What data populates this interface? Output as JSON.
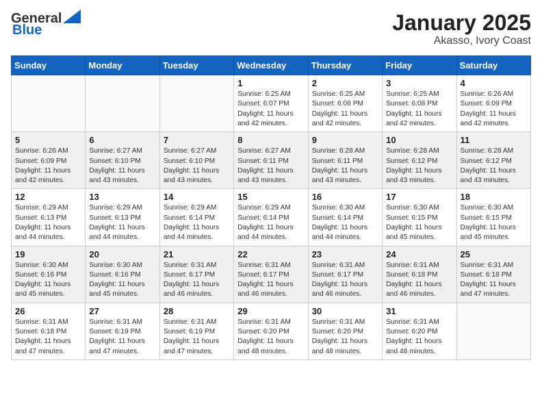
{
  "logo": {
    "general": "General",
    "blue": "Blue"
  },
  "title": "January 2025",
  "subtitle": "Akasso, Ivory Coast",
  "weekdays": [
    "Sunday",
    "Monday",
    "Tuesday",
    "Wednesday",
    "Thursday",
    "Friday",
    "Saturday"
  ],
  "weeks": [
    [
      {
        "day": "",
        "info": ""
      },
      {
        "day": "",
        "info": ""
      },
      {
        "day": "",
        "info": ""
      },
      {
        "day": "1",
        "info": "Sunrise: 6:25 AM\nSunset: 6:07 PM\nDaylight: 11 hours\nand 42 minutes."
      },
      {
        "day": "2",
        "info": "Sunrise: 6:25 AM\nSunset: 6:08 PM\nDaylight: 11 hours\nand 42 minutes."
      },
      {
        "day": "3",
        "info": "Sunrise: 6:25 AM\nSunset: 6:08 PM\nDaylight: 11 hours\nand 42 minutes."
      },
      {
        "day": "4",
        "info": "Sunrise: 6:26 AM\nSunset: 6:09 PM\nDaylight: 11 hours\nand 42 minutes."
      }
    ],
    [
      {
        "day": "5",
        "info": "Sunrise: 6:26 AM\nSunset: 6:09 PM\nDaylight: 11 hours\nand 42 minutes."
      },
      {
        "day": "6",
        "info": "Sunrise: 6:27 AM\nSunset: 6:10 PM\nDaylight: 11 hours\nand 43 minutes."
      },
      {
        "day": "7",
        "info": "Sunrise: 6:27 AM\nSunset: 6:10 PM\nDaylight: 11 hours\nand 43 minutes."
      },
      {
        "day": "8",
        "info": "Sunrise: 6:27 AM\nSunset: 6:11 PM\nDaylight: 11 hours\nand 43 minutes."
      },
      {
        "day": "9",
        "info": "Sunrise: 6:28 AM\nSunset: 6:11 PM\nDaylight: 11 hours\nand 43 minutes."
      },
      {
        "day": "10",
        "info": "Sunrise: 6:28 AM\nSunset: 6:12 PM\nDaylight: 11 hours\nand 43 minutes."
      },
      {
        "day": "11",
        "info": "Sunrise: 6:28 AM\nSunset: 6:12 PM\nDaylight: 11 hours\nand 43 minutes."
      }
    ],
    [
      {
        "day": "12",
        "info": "Sunrise: 6:29 AM\nSunset: 6:13 PM\nDaylight: 11 hours\nand 44 minutes."
      },
      {
        "day": "13",
        "info": "Sunrise: 6:29 AM\nSunset: 6:13 PM\nDaylight: 11 hours\nand 44 minutes."
      },
      {
        "day": "14",
        "info": "Sunrise: 6:29 AM\nSunset: 6:14 PM\nDaylight: 11 hours\nand 44 minutes."
      },
      {
        "day": "15",
        "info": "Sunrise: 6:29 AM\nSunset: 6:14 PM\nDaylight: 11 hours\nand 44 minutes."
      },
      {
        "day": "16",
        "info": "Sunrise: 6:30 AM\nSunset: 6:14 PM\nDaylight: 11 hours\nand 44 minutes."
      },
      {
        "day": "17",
        "info": "Sunrise: 6:30 AM\nSunset: 6:15 PM\nDaylight: 11 hours\nand 45 minutes."
      },
      {
        "day": "18",
        "info": "Sunrise: 6:30 AM\nSunset: 6:15 PM\nDaylight: 11 hours\nand 45 minutes."
      }
    ],
    [
      {
        "day": "19",
        "info": "Sunrise: 6:30 AM\nSunset: 6:16 PM\nDaylight: 11 hours\nand 45 minutes."
      },
      {
        "day": "20",
        "info": "Sunrise: 6:30 AM\nSunset: 6:16 PM\nDaylight: 11 hours\nand 45 minutes."
      },
      {
        "day": "21",
        "info": "Sunrise: 6:31 AM\nSunset: 6:17 PM\nDaylight: 11 hours\nand 46 minutes."
      },
      {
        "day": "22",
        "info": "Sunrise: 6:31 AM\nSunset: 6:17 PM\nDaylight: 11 hours\nand 46 minutes."
      },
      {
        "day": "23",
        "info": "Sunrise: 6:31 AM\nSunset: 6:17 PM\nDaylight: 11 hours\nand 46 minutes."
      },
      {
        "day": "24",
        "info": "Sunrise: 6:31 AM\nSunset: 6:18 PM\nDaylight: 11 hours\nand 46 minutes."
      },
      {
        "day": "25",
        "info": "Sunrise: 6:31 AM\nSunset: 6:18 PM\nDaylight: 11 hours\nand 47 minutes."
      }
    ],
    [
      {
        "day": "26",
        "info": "Sunrise: 6:31 AM\nSunset: 6:18 PM\nDaylight: 11 hours\nand 47 minutes."
      },
      {
        "day": "27",
        "info": "Sunrise: 6:31 AM\nSunset: 6:19 PM\nDaylight: 11 hours\nand 47 minutes."
      },
      {
        "day": "28",
        "info": "Sunrise: 6:31 AM\nSunset: 6:19 PM\nDaylight: 11 hours\nand 47 minutes."
      },
      {
        "day": "29",
        "info": "Sunrise: 6:31 AM\nSunset: 6:20 PM\nDaylight: 11 hours\nand 48 minutes."
      },
      {
        "day": "30",
        "info": "Sunrise: 6:31 AM\nSunset: 6:20 PM\nDaylight: 11 hours\nand 48 minutes."
      },
      {
        "day": "31",
        "info": "Sunrise: 6:31 AM\nSunset: 6:20 PM\nDaylight: 11 hours\nand 48 minutes."
      },
      {
        "day": "",
        "info": ""
      }
    ]
  ]
}
